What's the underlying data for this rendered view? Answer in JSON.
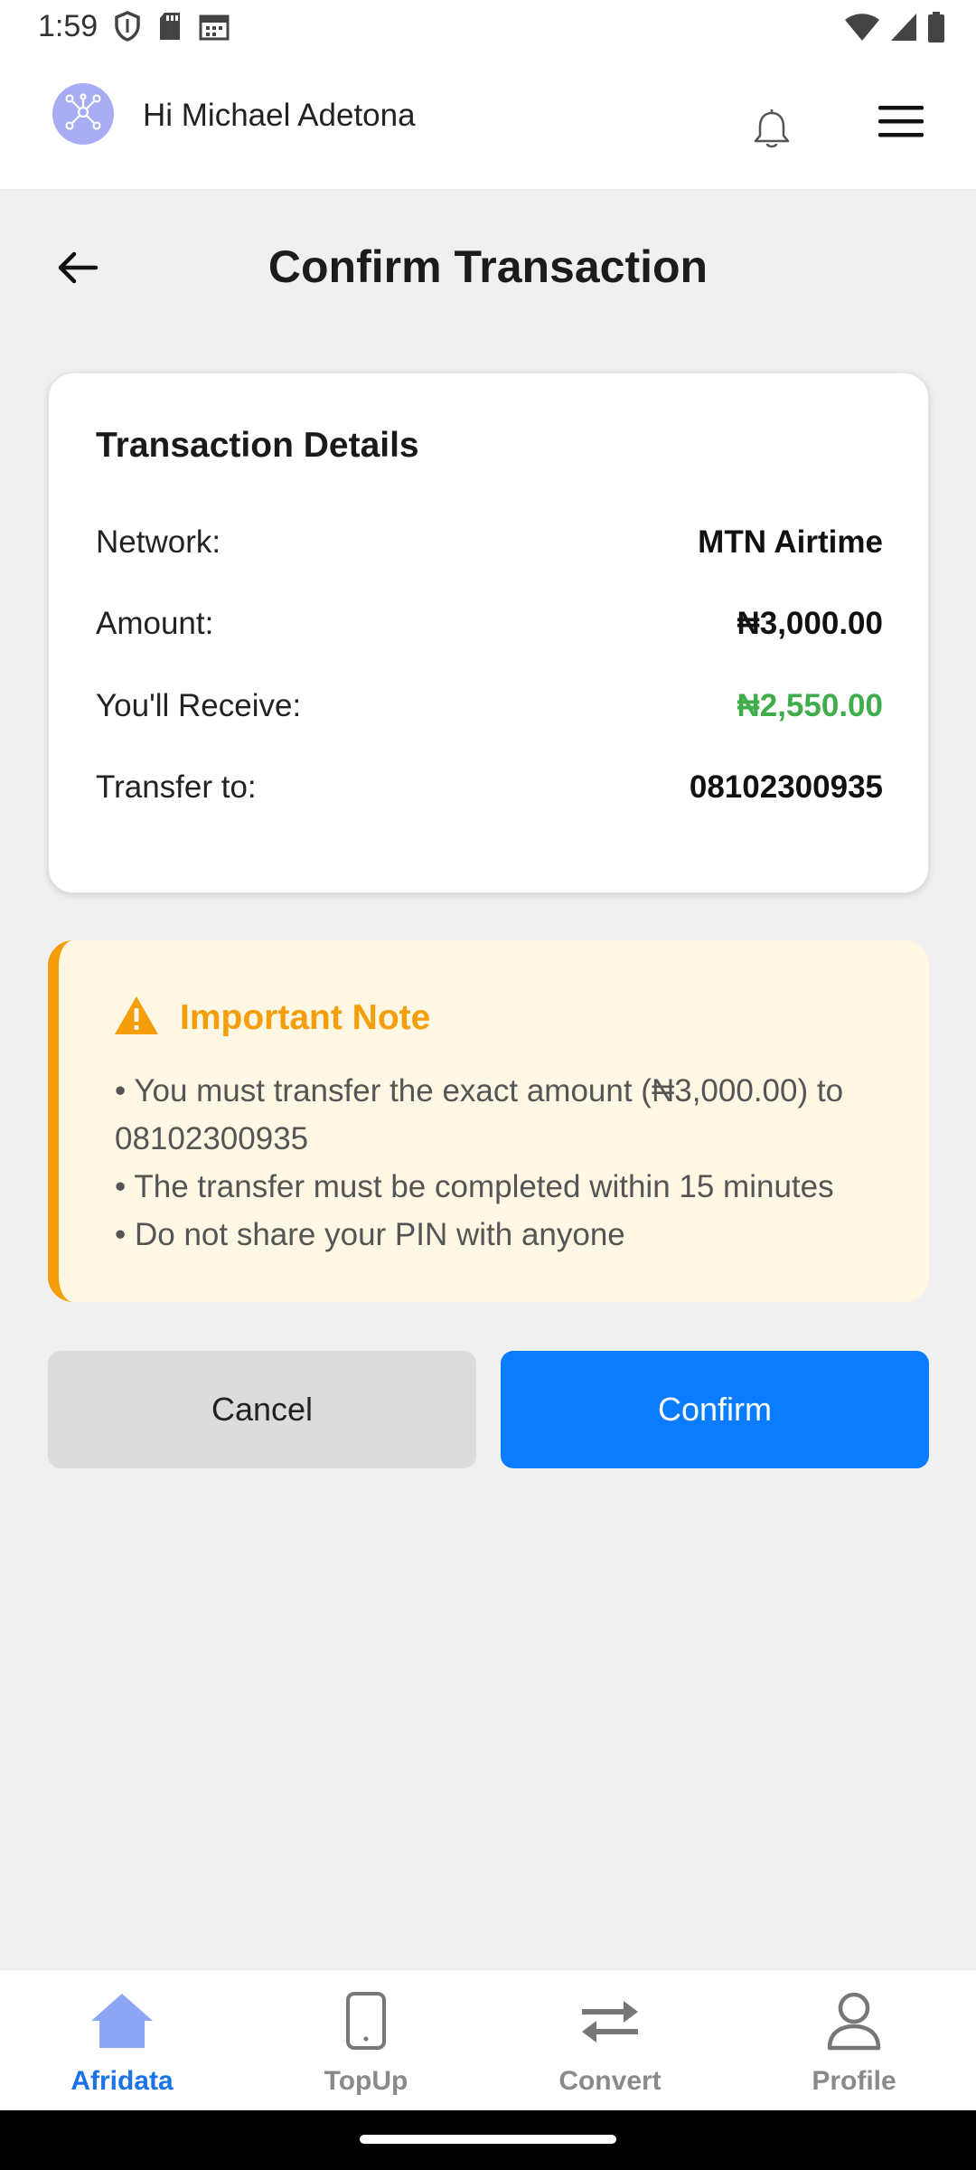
{
  "status_bar": {
    "time": "1:59",
    "left_icons": [
      "shield-icon",
      "sd-card-icon",
      "calendar-icon"
    ],
    "right_icons": [
      "wifi-icon",
      "signal-icon",
      "battery-icon"
    ]
  },
  "header": {
    "greeting": "Hi Michael Adetona",
    "avatar_icon": "network-logo-icon",
    "avatar_color": "#a8acf2",
    "notification_icon": "bell-icon",
    "menu_icon": "hamburger-menu-icon"
  },
  "page": {
    "title": "Confirm Transaction",
    "back_icon": "arrow-left-icon"
  },
  "details": {
    "title": "Transaction Details",
    "rows": [
      {
        "label": "Network:",
        "value": "MTN Airtime"
      },
      {
        "label": "Amount:",
        "value": "₦3,000.00"
      },
      {
        "label": "You'll Receive:",
        "value": "₦2,550.00",
        "value_color": "#3fae4a"
      },
      {
        "label": "Transfer to:",
        "value": "08102300935"
      }
    ]
  },
  "note": {
    "title": "Important Note",
    "icon": "warning-icon",
    "accent_color": "#f59e0b",
    "lines": [
      "• You must transfer the exact amount (₦3,000.00) to 08102300935",
      "• The transfer must be completed within 15 minutes",
      "• Do not share your PIN with anyone"
    ]
  },
  "actions": {
    "cancel_label": "Cancel",
    "confirm_label": "Confirm",
    "confirm_color": "#0a7cff"
  },
  "bottom_nav": {
    "items": [
      {
        "label": "Afridata",
        "icon": "home-icon",
        "active": true
      },
      {
        "label": "TopUp",
        "icon": "phone-icon",
        "active": false
      },
      {
        "label": "Convert",
        "icon": "swap-arrows-icon",
        "active": false
      },
      {
        "label": "Profile",
        "icon": "user-icon",
        "active": false
      }
    ],
    "active_color": "#1a73e8"
  }
}
